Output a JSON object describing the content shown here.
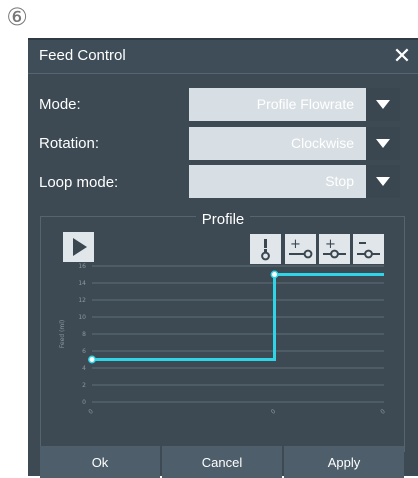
{
  "marker": "⑥",
  "window": {
    "title": "Feed Control",
    "close_glyph": "✕"
  },
  "fields": {
    "mode": {
      "label": "Mode:",
      "value": "Profile Flowrate"
    },
    "rotation": {
      "label": "Rotation:",
      "value": "Clockwise"
    },
    "loop": {
      "label": "Loop mode:",
      "value": "Stop"
    }
  },
  "profile": {
    "title": "Profile",
    "tools": [
      "add-point-icon",
      "add-after-icon",
      "insert-point-icon",
      "remove-point-icon"
    ]
  },
  "chart_data": {
    "type": "line",
    "ylabel": "Feed (ml)",
    "ylim": [
      0,
      16
    ],
    "yticks": [
      0,
      2,
      4,
      6,
      8,
      10,
      12,
      14,
      16
    ],
    "xtick_labels": [
      "0",
      "0",
      "0"
    ],
    "series": [
      {
        "points": [
          [
            0,
            5
          ],
          [
            1,
            5
          ],
          [
            1,
            15
          ],
          [
            1.6,
            15
          ]
        ],
        "color": "#2fd5e6"
      }
    ],
    "markers": [
      [
        0,
        5
      ],
      [
        1,
        15
      ]
    ]
  },
  "footer": {
    "ok": "Ok",
    "cancel": "Cancel",
    "apply": "Apply"
  },
  "colors": {
    "accent": "#2fd5e6",
    "dialog_bg": "#3d4a54"
  }
}
